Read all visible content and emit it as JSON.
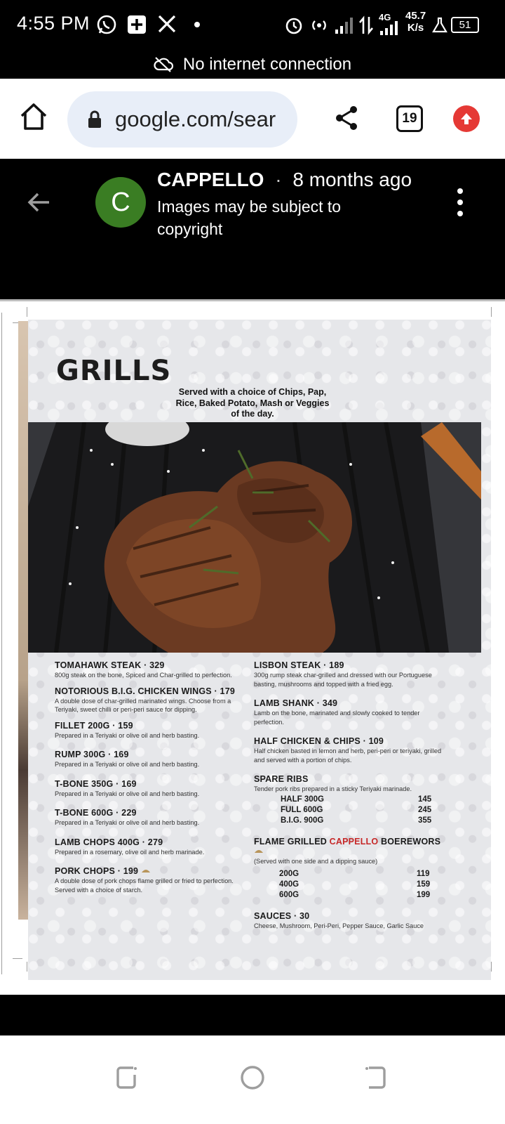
{
  "status_bar": {
    "time": "4:55 PM",
    "network_speed_value": "45.7",
    "network_speed_unit": "K/s",
    "network_type": "4G",
    "battery": "51",
    "icons": [
      "whatsapp-icon",
      "plus-square-icon",
      "x-icon",
      "dot-icon",
      "alarm-icon",
      "hotspot-icon",
      "signal-icon",
      "data-arrows-icon",
      "signal-4g-icon",
      "lab-flask-icon",
      "battery-icon"
    ]
  },
  "banner": {
    "text": "No internet connection"
  },
  "browser": {
    "url": "google.com/sear",
    "tab_count": "19"
  },
  "viewer": {
    "avatar_letter": "C",
    "source_name": "CAPPELLO",
    "separator": "·",
    "age": "8 months ago",
    "copyright": "Images may be subject to copyright"
  },
  "menu": {
    "title": "GRILLS",
    "subtitle": "Served with a choice of Chips, Pap, Rice, Baked Potato, Mash or Veggies of the day.",
    "left_items": [
      {
        "name": "TOMAHAWK STEAK  · 329",
        "desc": "800g steak on the bone, Spiced and Char-grilled to perfection."
      },
      {
        "name": "NOTORIOUS B.I.G. CHICKEN WINGS · 179",
        "desc": "A double dose of char-grilled marinated wings. Choose from a Teriyaki, sweet chilli or peri-peri sauce for dipping."
      },
      {
        "name": "FILLET 200G · 159",
        "desc": "Prepared in a Teriyaki or olive oil and herb basting."
      },
      {
        "name": "RUMP 300G · 169",
        "desc": "Prepared in a Teriyaki or olive oil and herb basting."
      },
      {
        "name": "T-BONE 350G · 169",
        "desc": "Prepared in a Teriyaki or olive oil and herb basting."
      },
      {
        "name": "T-BONE 600G · 229",
        "desc": "Prepared in a Teriyaki or olive oil and herb basting."
      },
      {
        "name": "LAMB CHOPS 400G · 279",
        "desc": "Prepared in a rosemary, olive oil and herb marinade."
      },
      {
        "name": "PORK CHOPS · 199",
        "desc": "A double dose of pork chops flame grilled or fried to perfection. Served with a choice of starch."
      }
    ],
    "right_items": [
      {
        "name": "LISBON STEAK · 189",
        "desc": "300g rump steak char-grilled and dressed with our Portuguese basting, mushrooms and topped with a fried egg."
      },
      {
        "name": "LAMB SHANK · 349",
        "desc": "Lamb on the bone, marinated and slowly cooked to tender perfection."
      },
      {
        "name": "HALF CHICKEN & CHIPS · 109",
        "desc": "Half chicken basted in lemon and herb, peri-peri or teriyaki, grilled and served with a portion of chips."
      }
    ],
    "spare_ribs": {
      "name": "SPARE RIBS",
      "desc": "Tender pork ribs prepared in a sticky Teriyaki marinade.",
      "rows": [
        {
          "label": "HALF  300G",
          "price": "145"
        },
        {
          "label": "FULL  600G",
          "price": "245"
        },
        {
          "label": "B.I.G.  900G",
          "price": "355"
        }
      ]
    },
    "boerewors": {
      "name_prefix": "FLAME GRILLED ",
      "name_brand": "CAPPELLO",
      "name_suffix": " BOEREWORS",
      "desc": "(Served with one side and a dipping sauce)",
      "rows": [
        {
          "label": "200G",
          "price": "119"
        },
        {
          "label": "400G",
          "price": "159"
        },
        {
          "label": "600G",
          "price": "199"
        }
      ]
    },
    "sauces": {
      "name": "SAUCES · 30",
      "desc": "Cheese, Mushroom, Peri-Peri, Pepper Sauce, Garlic Sauce"
    }
  },
  "nav": {
    "icons": [
      "recent-apps-icon",
      "home-circle-icon",
      "back-icon"
    ]
  },
  "colors": {
    "brand_red": "#c62828",
    "avatar_green": "#3a7d23",
    "update_red": "#e53935",
    "url_bar_bg": "#e8eef8"
  }
}
